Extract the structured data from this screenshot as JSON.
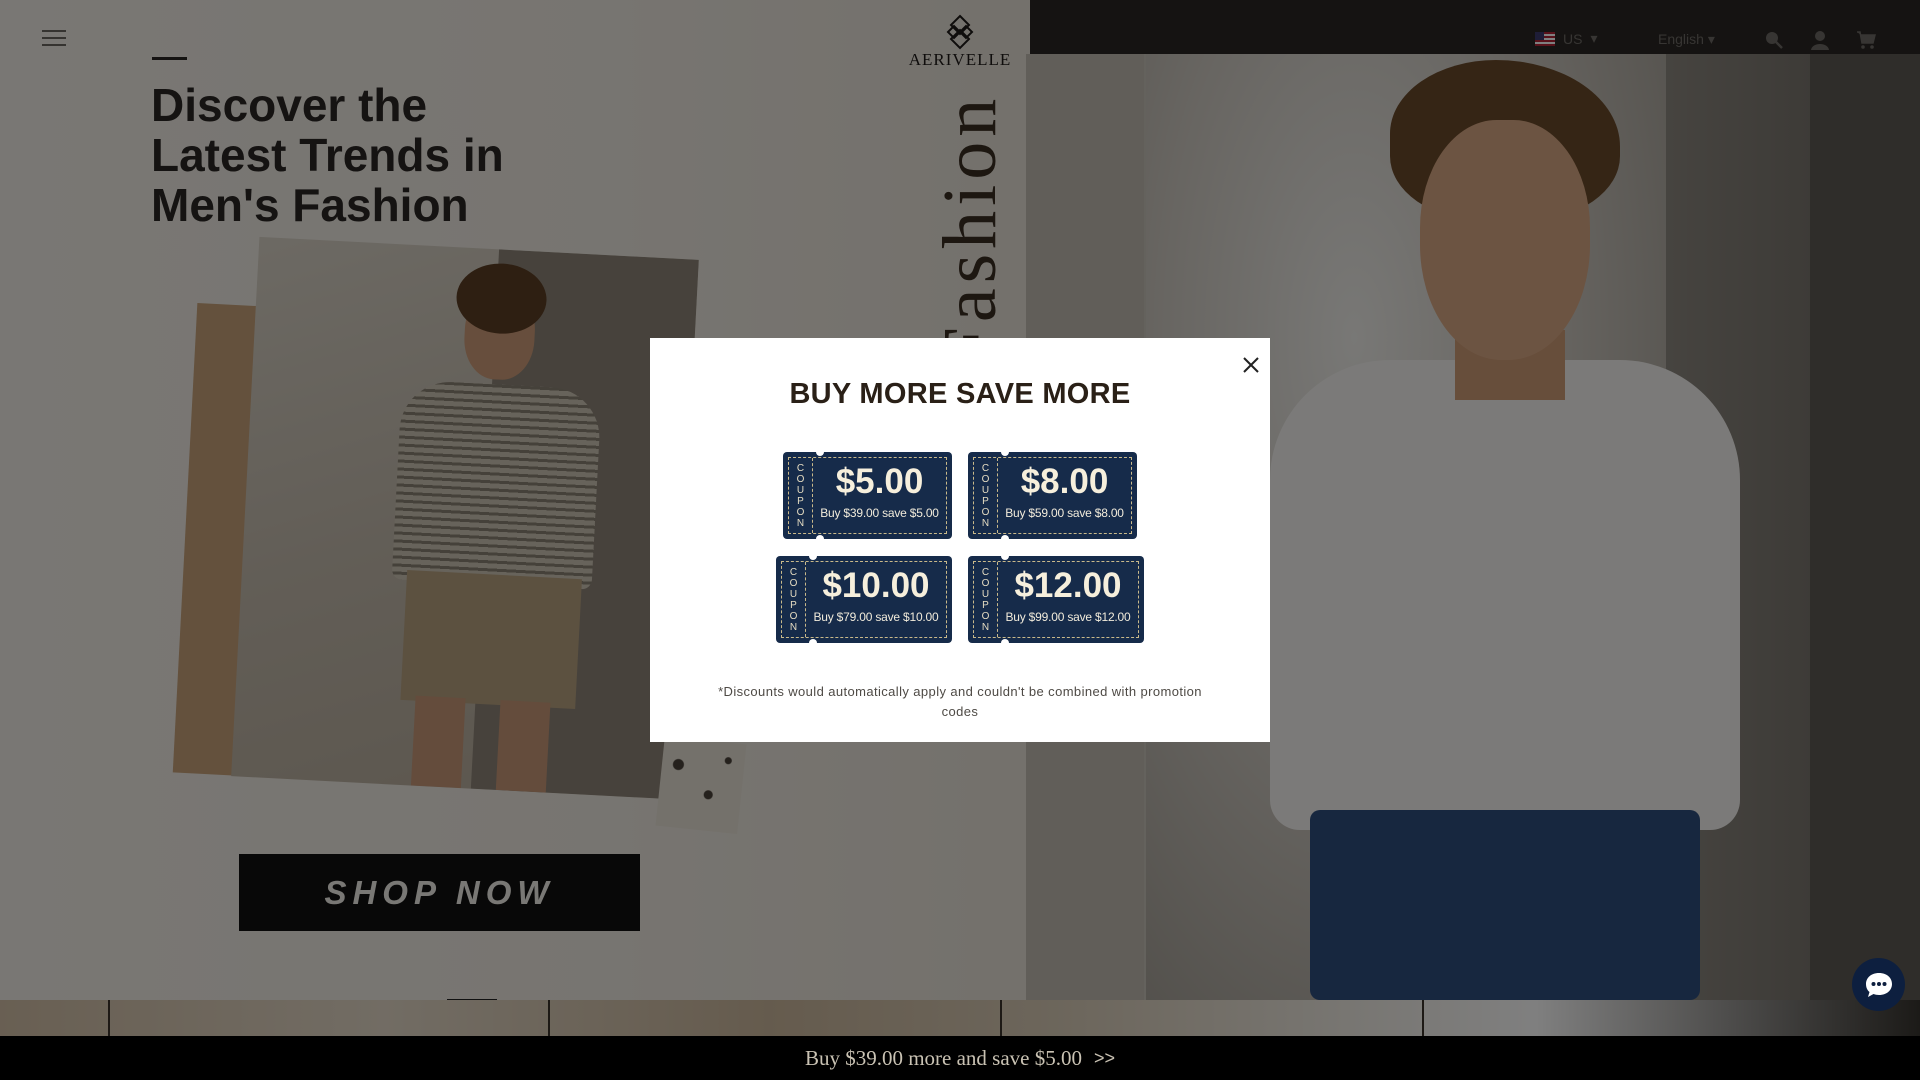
{
  "brand": {
    "logo_text": "AERIVELLE"
  },
  "header": {
    "region_code": "US",
    "language": "English",
    "icons": [
      "menu-icon",
      "search-icon",
      "account-icon",
      "cart-icon"
    ]
  },
  "hero": {
    "title": "Discover the Latest Trends in Men's Fashion",
    "vertical_word": "Men's Fashion",
    "cta_label": "SHOP NOW"
  },
  "modal": {
    "title": "BUY MORE SAVE MORE",
    "coupons": [
      {
        "side_label": "COUPON",
        "amount": "$5.00",
        "description": "Buy $39.00 save $5.00"
      },
      {
        "side_label": "COUPON",
        "amount": "$8.00",
        "description": "Buy $59.00 save $8.00"
      },
      {
        "side_label": "COUPON",
        "amount": "$10.00",
        "description": "Buy $79.00 save $10.00"
      },
      {
        "side_label": "COUPON",
        "amount": "$12.00",
        "description": "Buy $99.00 save $12.00"
      }
    ],
    "disclaimer": "*Discounts would automatically apply and couldn't be combined with promotion codes"
  },
  "promo_bar": {
    "text": "Buy $39.00 more and save $5.00",
    "arrow": ">>"
  },
  "colors": {
    "coupon_bg": "#162b4a",
    "coupon_text": "#f6efdc",
    "promo_bar_bg": "#000000",
    "chat_bg": "#0d1f3f"
  }
}
